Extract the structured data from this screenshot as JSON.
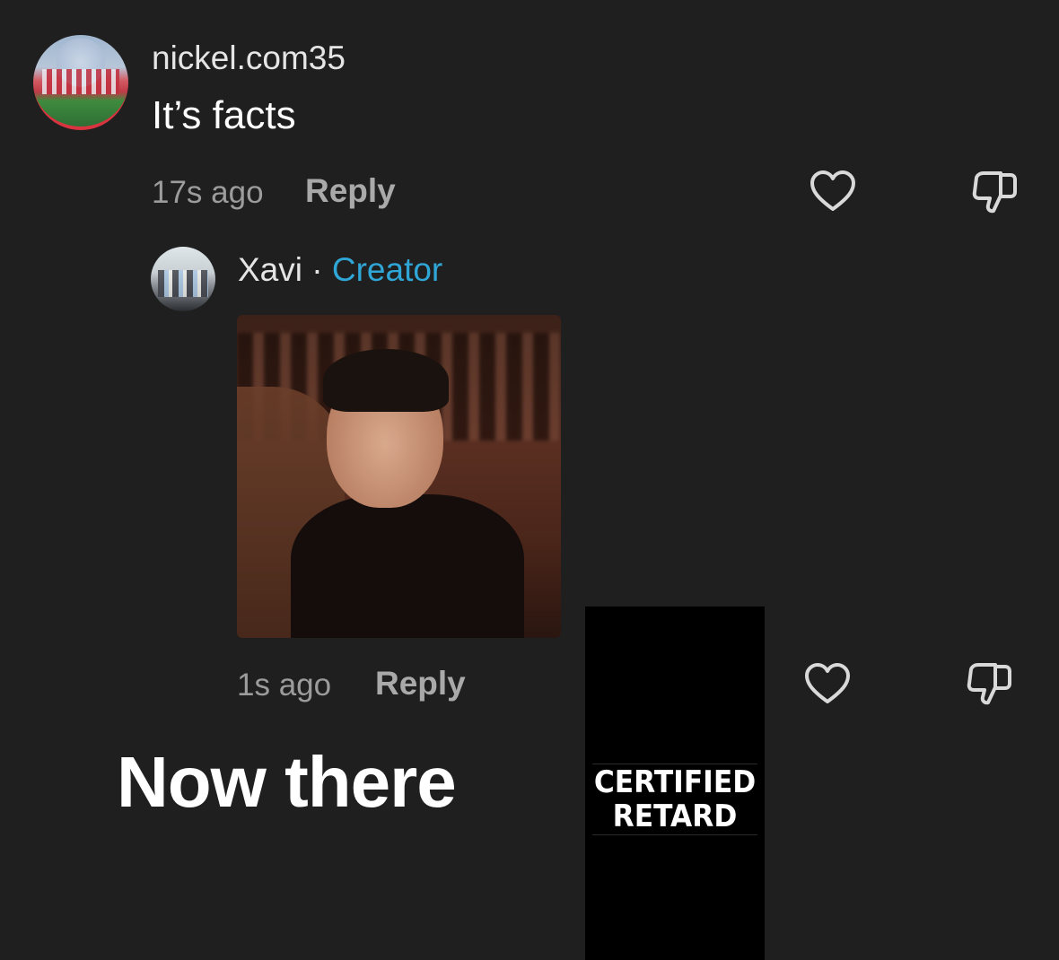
{
  "comment": {
    "username": "nickel.com35",
    "text": "It’s facts",
    "timestamp": "17s ago",
    "reply_label": "Reply",
    "like_icon": "heart-outline-icon",
    "dislike_icon": "thumbs-down-outline-icon"
  },
  "reply": {
    "username": "Xavi",
    "separator": "·",
    "badge": "Creator",
    "badge_color": "#2fa6d6",
    "timestamp": "1s ago",
    "reply_label": "Reply",
    "like_icon": "heart-outline-icon",
    "dislike_icon": "thumbs-down-outline-icon"
  },
  "overlay": {
    "caption": "Now there",
    "label_line1": "CERTIFIED",
    "label_line2": "RETARD"
  }
}
